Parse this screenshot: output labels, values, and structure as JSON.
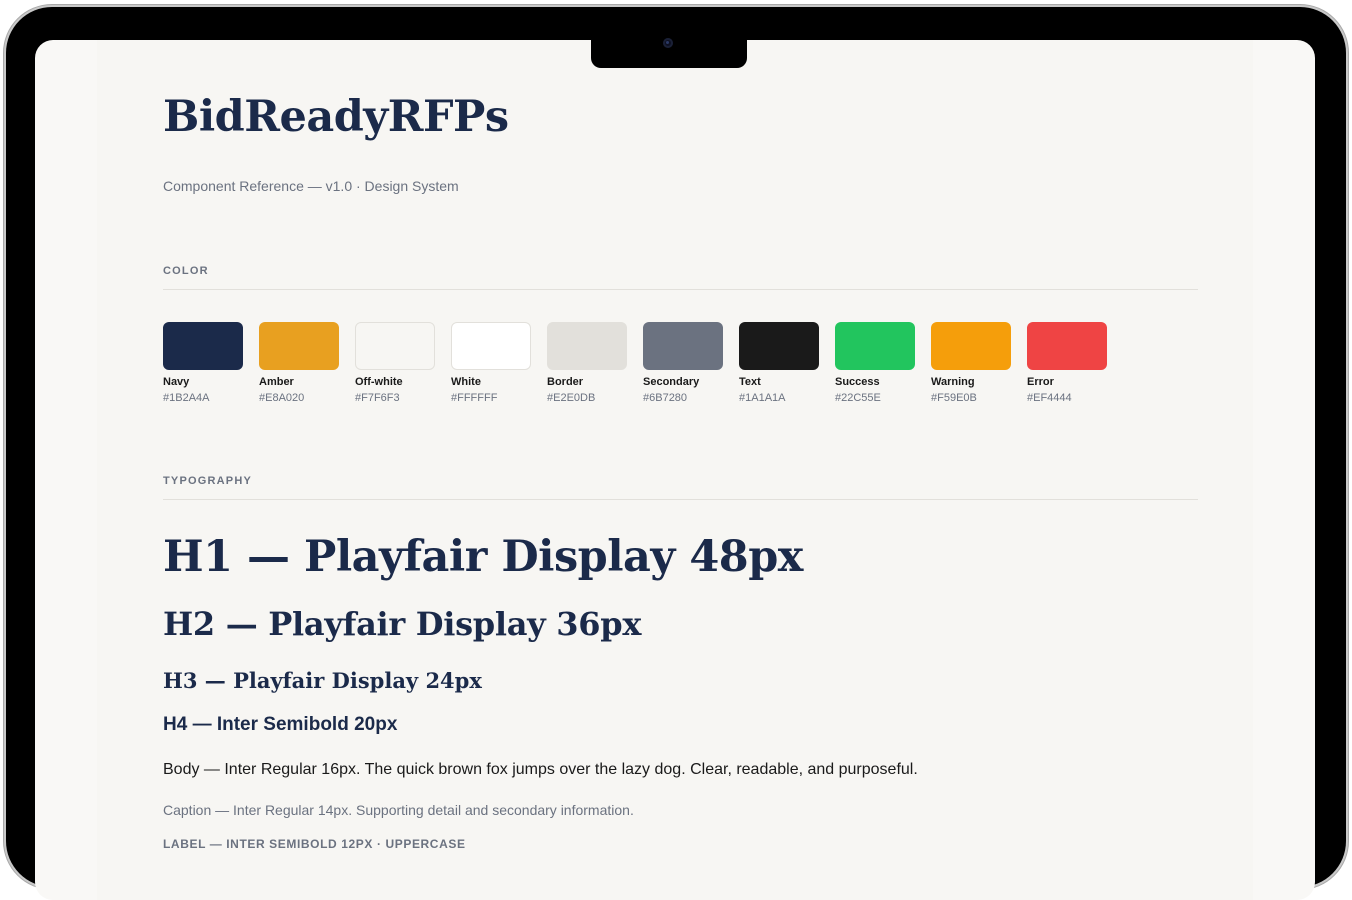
{
  "brand": {
    "title": "BidReadyRFPs",
    "subtitle": "Component Reference — v1.0 · Design System"
  },
  "sections": {
    "color": "COLOR",
    "typography": "TYPOGRAPHY"
  },
  "colors": [
    {
      "name": "Navy",
      "hex": "#1B2A4A",
      "value": "#1b2a4a",
      "bordered": false
    },
    {
      "name": "Amber",
      "hex": "#E8A020",
      "value": "#e8a020",
      "bordered": false
    },
    {
      "name": "Off-white",
      "hex": "#F7F6F3",
      "value": "#f7f6f3",
      "bordered": true
    },
    {
      "name": "White",
      "hex": "#FFFFFF",
      "value": "#ffffff",
      "bordered": true
    },
    {
      "name": "Border",
      "hex": "#E2E0DB",
      "value": "#e2e0db",
      "bordered": true
    },
    {
      "name": "Secondary",
      "hex": "#6B7280",
      "value": "#6b7280",
      "bordered": false
    },
    {
      "name": "Text",
      "hex": "#1A1A1A",
      "value": "#1a1a1a",
      "bordered": false
    },
    {
      "name": "Success",
      "hex": "#22C55E",
      "value": "#22c55e",
      "bordered": false
    },
    {
      "name": "Warning",
      "hex": "#F59E0B",
      "value": "#f59e0b",
      "bordered": false
    },
    {
      "name": "Error",
      "hex": "#EF4444",
      "value": "#ef4444",
      "bordered": false
    }
  ],
  "typography": {
    "h1": "H1 — Playfair Display 48px",
    "h2": "H2 — Playfair Display 36px",
    "h3": "H3 — Playfair Display 24px",
    "h4": "H4 — Inter Semibold 20px",
    "body": "Body — Inter Regular 16px. The quick brown fox jumps over the lazy dog. Clear, readable, and purposeful.",
    "caption": "Caption — Inter Regular 14px. Supporting detail and secondary information.",
    "label": "LABEL — INTER SEMIBOLD 12PX · UPPERCASE"
  }
}
